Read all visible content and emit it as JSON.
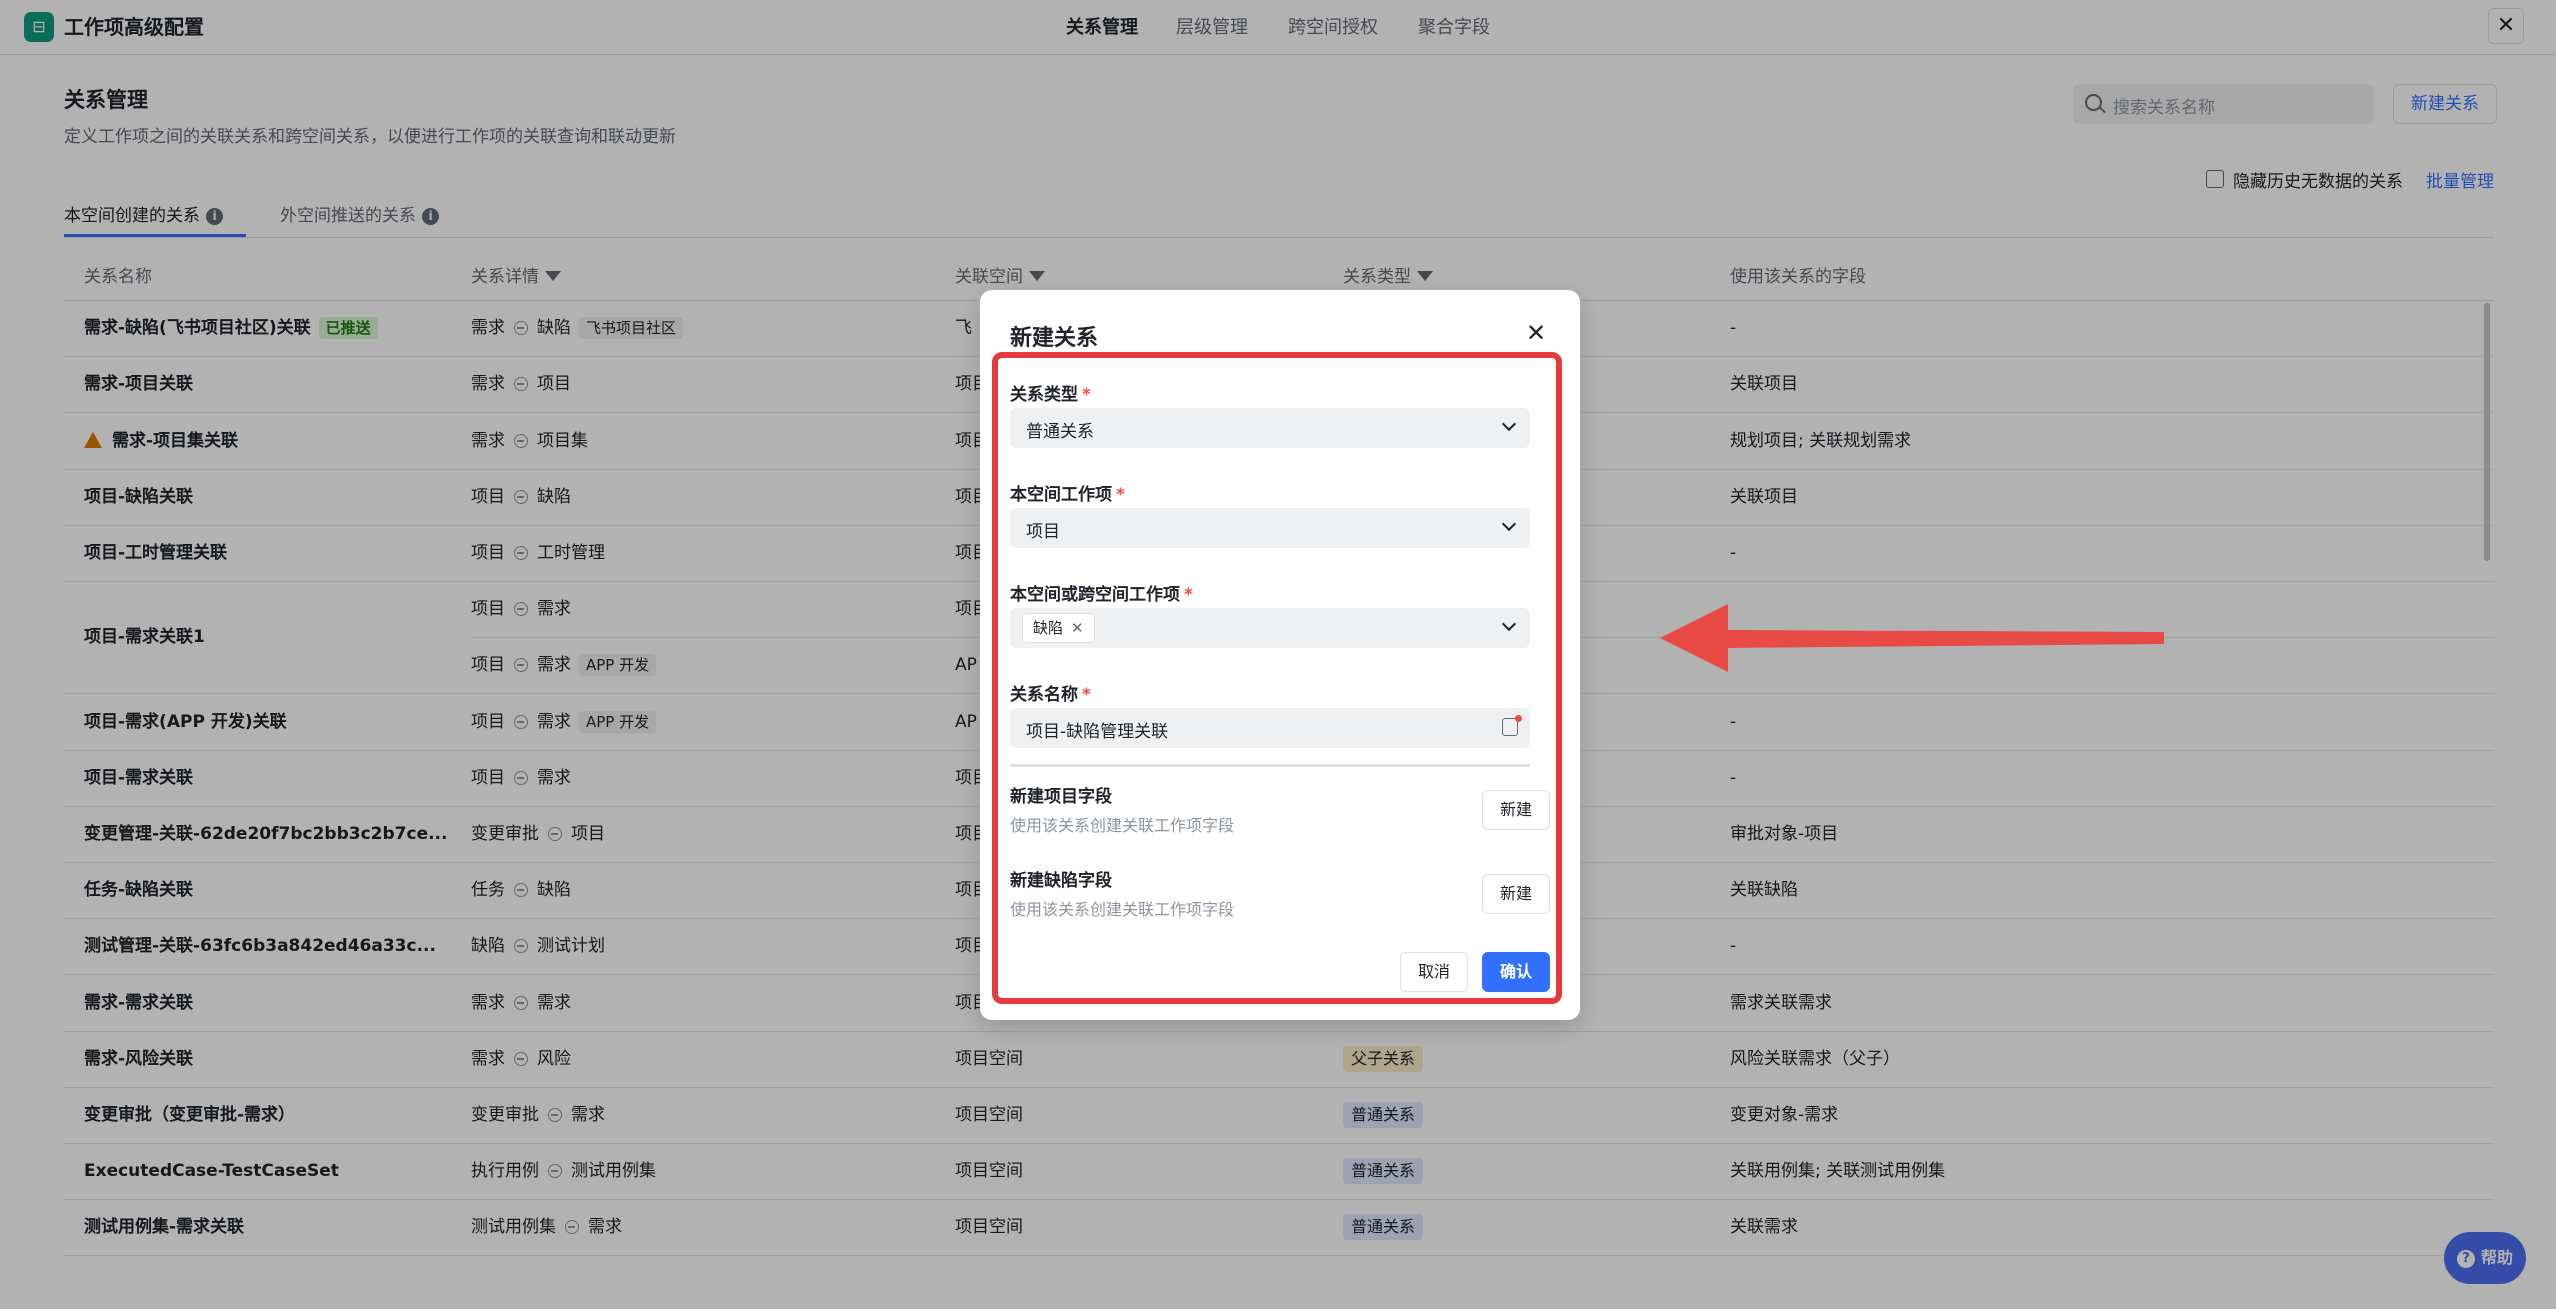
{
  "app": {
    "title": "工作项高级配置"
  },
  "top_tabs": [
    {
      "label": "关系管理",
      "active": true
    },
    {
      "label": "层级管理",
      "active": false
    },
    {
      "label": "跨空间授权",
      "active": false
    },
    {
      "label": "聚合字段",
      "active": false
    }
  ],
  "header": {
    "title": "关系管理",
    "description": "定义工作项之间的关联关系和跨空间关系，以便进行工作项的关联查询和联动更新",
    "search_placeholder": "搜索关系名称",
    "new_button": "新建关系",
    "hide_label": "隐藏历史无数据的关系",
    "batch_link": "批量管理"
  },
  "sub_tabs": [
    {
      "label": "本空间创建的关系",
      "active": true
    },
    {
      "label": "外空间推送的关系",
      "active": false
    }
  ],
  "table": {
    "columns": [
      "关系名称",
      "关系详情",
      "关联空间",
      "关系类型",
      "使用该关系的字段"
    ],
    "rows": [
      {
        "name": "需求-缺陷(飞书项目社区)关联",
        "name_tag": "已推送",
        "from": "需求",
        "to": "缺陷",
        "detail_tag": "飞书项目社区",
        "space": "飞",
        "type": "",
        "field": "-"
      },
      {
        "name": "需求-项目关联",
        "from": "需求",
        "to": "项目",
        "space": "项目",
        "type": "",
        "field": "关联项目"
      },
      {
        "name": "需求-项目集关联",
        "warning": true,
        "from": "需求",
        "to": "项目集",
        "space": "项目",
        "type": "",
        "field": "规划项目; 关联规划需求"
      },
      {
        "name": "项目-缺陷关联",
        "from": "项目",
        "to": "缺陷",
        "space": "项目",
        "type": "",
        "field": "关联项目"
      },
      {
        "name": "项目-工时管理关联",
        "from": "项目",
        "to": "工时管理",
        "space": "项目",
        "type": "",
        "field": "-"
      },
      {
        "name": "项目-需求关联1",
        "from": "项目",
        "to": "需求",
        "space": "项目",
        "type": "",
        "field": ""
      },
      {
        "name": "",
        "from": "项目",
        "to": "需求",
        "detail_tag": "APP 开发",
        "space": "AP",
        "type": "",
        "field": ""
      },
      {
        "name": "项目-需求(APP 开发)关联",
        "from": "项目",
        "to": "需求",
        "detail_tag": "APP 开发",
        "space": "AP",
        "type": "",
        "field": "-"
      },
      {
        "name": "项目-需求关联",
        "from": "项目",
        "to": "需求",
        "space": "项目",
        "type": "",
        "field": "-"
      },
      {
        "name": "变更管理-关联-62de20f7bc2bb3c2b7ce...",
        "from": "变更审批",
        "to": "项目",
        "space": "项目",
        "type": "",
        "field": "审批对象-项目"
      },
      {
        "name": "任务-缺陷关联",
        "from": "任务",
        "to": "缺陷",
        "space": "项目",
        "type": "",
        "field": "关联缺陷"
      },
      {
        "name": "测试管理-关联-63fc6b3a842ed46a33c...",
        "from": "缺陷",
        "to": "测试计划",
        "space": "项目",
        "type": "",
        "field": "-"
      },
      {
        "name": "需求-需求关联",
        "from": "需求",
        "to": "需求",
        "space": "项目",
        "type": "",
        "field": "需求关联需求"
      },
      {
        "name": "需求-风险关联",
        "from": "需求",
        "to": "风险",
        "space": "项目空间",
        "type": "父子关系",
        "field": "风险关联需求（父子）"
      },
      {
        "name": "变更审批（变更审批-需求）",
        "from": "变更审批",
        "to": "需求",
        "space": "项目空间",
        "type": "普通关系",
        "field": "变更对象-需求"
      },
      {
        "name": "ExecutedCase-TestCaseSet",
        "from": "执行用例",
        "to": "测试用例集",
        "space": "项目空间",
        "type": "普通关系",
        "field": "关联用例集; 关联测试用例集"
      },
      {
        "name": "测试用例集-需求关联",
        "from": "测试用例集",
        "to": "需求",
        "space": "项目空间",
        "type": "普通关系",
        "field": "关联需求"
      }
    ]
  },
  "modal": {
    "title": "新建关系",
    "fields": {
      "relation_type": {
        "label": "关系类型",
        "value": "普通关系"
      },
      "local_item": {
        "label": "本空间工作项",
        "value": "项目"
      },
      "target_item": {
        "label": "本空间或跨空间工作项",
        "chip": "缺陷"
      },
      "relation_name": {
        "label": "关系名称",
        "value": "项目-缺陷管理关联"
      }
    },
    "new_project_field": {
      "title": "新建项目字段",
      "desc": "使用该关系创建关联工作项字段",
      "button": "新建"
    },
    "new_defect_field": {
      "title": "新建缺陷字段",
      "desc": "使用该关系创建关联工作项字段",
      "button": "新建"
    },
    "cancel": "取消",
    "confirm": "确认"
  },
  "help": {
    "label": "帮助"
  },
  "colors": {
    "accent": "#3370ff",
    "annotation_red": "#e63b3b"
  }
}
